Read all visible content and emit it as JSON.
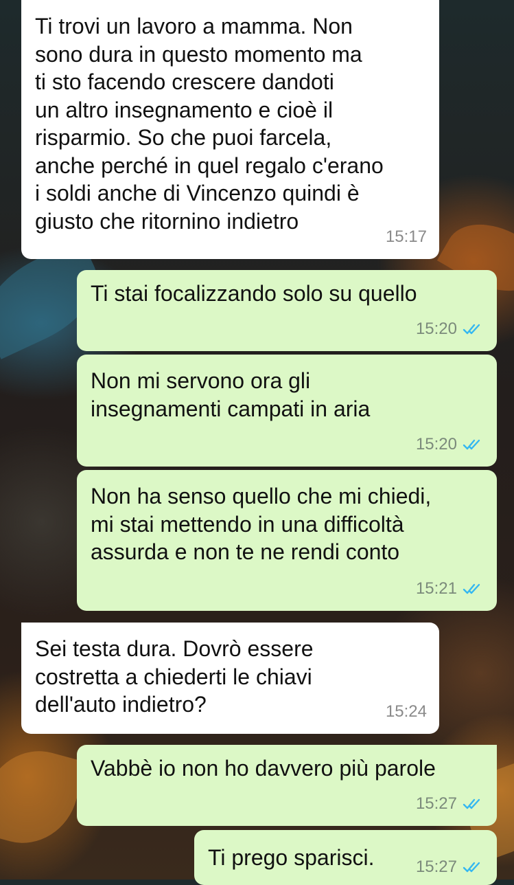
{
  "messages": [
    {
      "side": "in",
      "text": "Ti trovi un lavoro a mamma. Non\nsono dura in questo momento ma\nti sto facendo crescere dandoti\nun altro insegnamento e cioè il\nrisparmio. So che puoi farcela,\nanche perché in quel regalo c'erano\ni soldi anche di Vincenzo quindi è\ngiusto che ritornino indietro",
      "time": "15:17"
    },
    {
      "side": "out",
      "text": "Ti stai focalizzando solo su quello",
      "time": "15:20",
      "status": "read"
    },
    {
      "side": "out",
      "text": "Non mi servono ora gli\ninsegnamenti campati in aria",
      "time": "15:20",
      "status": "read"
    },
    {
      "side": "out",
      "text": "Non ha senso quello che mi chiedi,\nmi stai mettendo in una difficoltà\nassurda e non te ne rendi conto",
      "time": "15:21",
      "status": "read"
    },
    {
      "side": "in",
      "text": "Sei testa dura. Dovrò essere\ncostretta a chiederti le chiavi\ndell'auto indietro?",
      "time": "15:24"
    },
    {
      "side": "out",
      "text": "Vabbè io non ho davvero più parole",
      "time": "15:27",
      "status": "read"
    },
    {
      "side": "out",
      "text": "Ti prego sparisci.",
      "time": "15:27",
      "status": "read"
    }
  ],
  "icons": {
    "read_receipt": "double-check-icon"
  },
  "colors": {
    "incoming": "#ffffff",
    "outgoing": "#dcf8c6",
    "read_tick": "#34b7f1"
  }
}
